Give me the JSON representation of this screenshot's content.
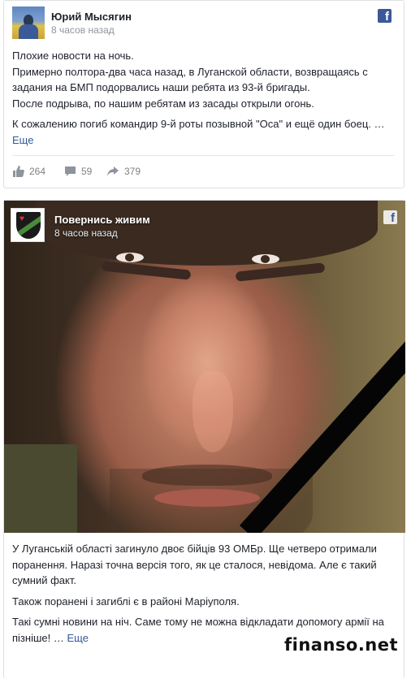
{
  "post1": {
    "author": "Юрий Мысягин",
    "time": "8 часов назад",
    "paragraphs": [
      "Плохие новости на ночь.\nПримерно полтора-два часа назад, в Луганской области, возвращаясь с задания на БМП подорвались наши ребята из 93-й бригады.\nПосле подрыва, по нашим ребятам из засады открыли огонь.",
      "К сожалению погиб командир 9-й роты позывной \"Оса\" и ещё один боец."
    ],
    "ellipsis": "…",
    "more_label": "Еще",
    "stats": {
      "likes": "264",
      "comments": "59",
      "shares": "379"
    },
    "fb_icon": "facebook-icon"
  },
  "post2": {
    "author": "Повернись живим",
    "time": "8 часов назад",
    "paragraphs": [
      "У Луганській області загинуло двоє бійців 93 ОМБр. Ще четверо отримали поранення. Наразі точна версія того, як це сталося, невідома. Але є такий сумний факт.",
      "Також поранені і загиблі є в районі Маріуполя.",
      "Такі сумні новини на ніч. Саме тому не можна відкладати допомогу армії на пізніше!"
    ],
    "ellipsis": "…",
    "more_label": "Еще",
    "fb_icon": "facebook-icon"
  },
  "watermark": "finanso.net",
  "colors": {
    "link": "#365899",
    "fb_blue": "#3b5998",
    "muted": "#90949c",
    "border": "#dddfe2"
  }
}
